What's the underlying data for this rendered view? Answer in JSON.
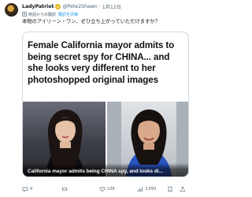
{
  "tweet": {
    "author_name": "LadyPatriot",
    "handle": "@Pete2Shawn",
    "time": "1月12日",
    "translate_label": "英語からの翻訳",
    "translate_link": "翻訳を評価",
    "text": "本物のアイリーン・ワン、ぜひ立ち上がっていただけますか？"
  },
  "card": {
    "heading": "Female California mayor admits to being secret spy for CHINA... and she looks very different to her photoshopped original images",
    "caption": "California mayor admits being CHINA spy, and looks di..."
  },
  "actions": {
    "reply_count": "4",
    "retweet_count": "",
    "like_count": "138",
    "views_count": "3,693"
  },
  "colors": {
    "accent": "#1d9bf0",
    "muted": "#536471",
    "verified_gold": "#e2b719",
    "border": "#cfd9de"
  }
}
